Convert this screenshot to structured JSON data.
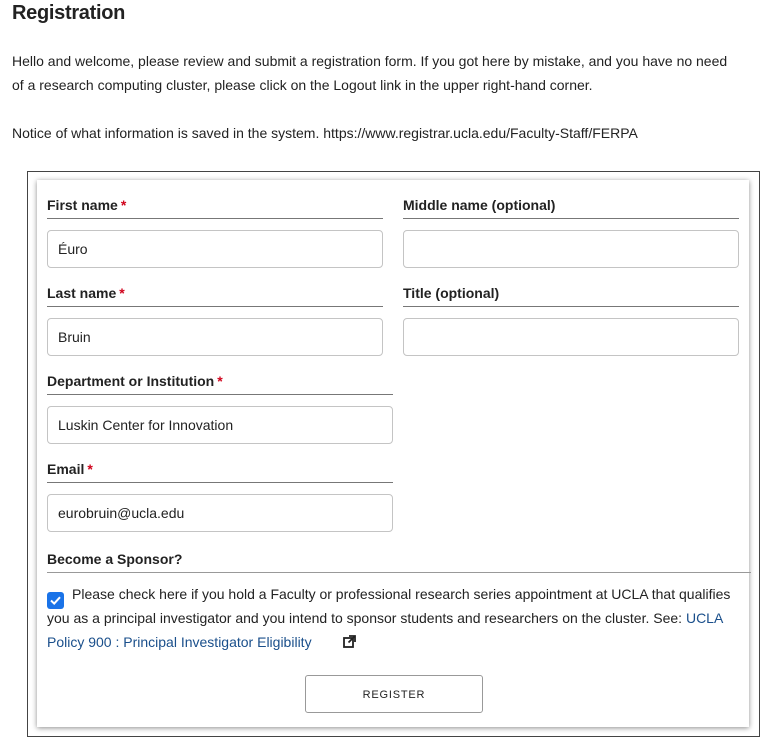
{
  "page": {
    "title": "Registration",
    "intro_line1": "Hello and welcome, please review and submit a registration form. If you got here by mistake, and you have no need",
    "intro_line2": "of a research computing cluster, please click on the Logout link in the upper right-hand corner.",
    "notice": "Notice of what information is saved in the system. https://www.registrar.ucla.edu/Faculty-Staff/FERPA"
  },
  "form": {
    "first_name": {
      "label": "First name",
      "required": "*",
      "value": "Éuro"
    },
    "middle_name": {
      "label": "Middle name (optional)",
      "value": ""
    },
    "last_name": {
      "label": "Last name",
      "required": "*",
      "value": "Bruin"
    },
    "title": {
      "label": "Title (optional)",
      "value": ""
    },
    "department": {
      "label": "Department or Institution",
      "required": "*",
      "value": "Luskin Center for Innovation"
    },
    "email": {
      "label": "Email",
      "required": "*",
      "value": "eurobruin@ucla.edu"
    },
    "sponsor": {
      "label": "Become a Sponsor?",
      "checked": true,
      "text": "Please check here if you hold a Faculty or professional research series appointment at UCLA that qualifies you as a principal investigator and you intend to sponsor students and researchers on the cluster. See: ",
      "link_text": "UCLA Policy 900 : Principal Investigator Eligibility",
      "link_icon": "external-link-icon"
    },
    "register_label": "REGISTER"
  },
  "colors": {
    "required": "#d0021b",
    "link": "#1a4f8b",
    "checkbox": "#1a73e8"
  }
}
